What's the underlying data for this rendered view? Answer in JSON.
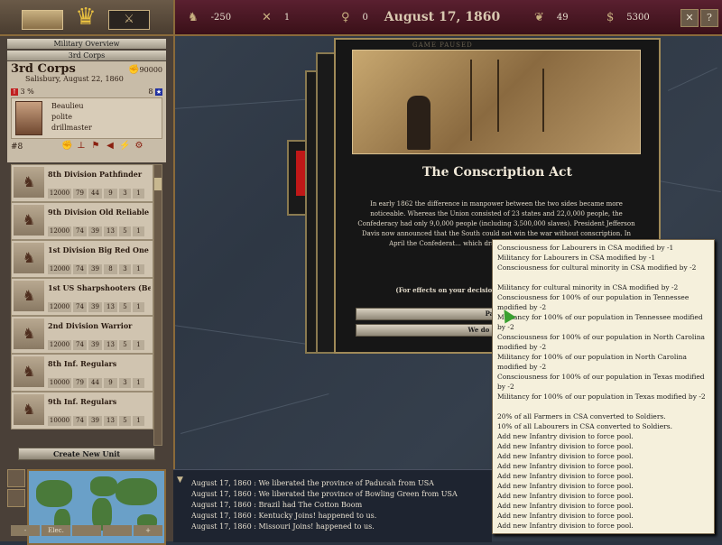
{
  "topbar": {
    "stat1": "-250",
    "stat2": "1",
    "stat3": "0",
    "date": "August 17, 1860",
    "stat4": "49",
    "money": "5300"
  },
  "left_panel": {
    "header": "Military Overview",
    "corps_label": "3rd Corps",
    "corps_name": "3rd Corps",
    "corps_location": "Salisbury, August 22, 1860",
    "strength": "90000",
    "organization": "3 %",
    "rank": "8",
    "leader": {
      "name": "Beaulieu",
      "trait1": "polite",
      "trait2": "drillmaster"
    },
    "leader_id": "#8",
    "units": [
      {
        "name": "8th Division Pathfinder",
        "stats": [
          "12000",
          "79",
          "44",
          "9",
          "3",
          "1"
        ]
      },
      {
        "name": "9th Division Old Reliable",
        "stats": [
          "12000",
          "74",
          "39",
          "13",
          "5",
          "1"
        ]
      },
      {
        "name": "1st Division Big Red One",
        "stats": [
          "12000",
          "74",
          "39",
          "8",
          "3",
          "1"
        ]
      },
      {
        "name": "1st US Sharpshooters (Be",
        "stats": [
          "12000",
          "74",
          "39",
          "13",
          "5",
          "1"
        ]
      },
      {
        "name": "2nd Division Warrior",
        "stats": [
          "12000",
          "74",
          "39",
          "13",
          "5",
          "1"
        ]
      },
      {
        "name": "8th Inf. Regulars",
        "stats": [
          "10000",
          "79",
          "44",
          "9",
          "3",
          "1"
        ]
      },
      {
        "name": "9th Inf. Regulars",
        "stats": [
          "10000",
          "74",
          "39",
          "13",
          "5",
          "1"
        ]
      }
    ],
    "create_button": "Create New Unit"
  },
  "event": {
    "paused": "GAME PAUSED",
    "title": "The Conscription Act",
    "body": "In early 1862 the difference in manpower between the two sides became more noticeable. Whereas the Union consisted of 23 states and 22,0,000 people, the Confederacy had only 9,0,000 people (including 3,500,000 slaves). President Jefferson Davis now announced that the South could not win the war without conscription. In April the Confederat... which drafted white men between ei... ser...",
    "hint": "(For effects on your decision, c... when you move the m...",
    "option1": "Pass...",
    "option2": "We do not nee..."
  },
  "tooltip": {
    "lines": [
      "Consciousness for Labourers in CSA modified by -1",
      "Militancy for Labourers in CSA modified by -1",
      "Consciousness for cultural minority in CSA modified by -2",
      "Militancy for cultural minority in CSA modified by -2",
      "Consciousness for 100% of our population in Tennessee modified by -2",
      "Militancy for 100% of our population in Tennessee modified by -2",
      "Consciousness for 100% of our population in North Carolina modified by -2",
      "Militancy for 100% of our population in North Carolina modified by -2",
      "Consciousness for 100% of our population in Texas modified by -2",
      "Militancy for 100% of our population in Texas modified by -2",
      "20% of all Farmers in CSA converted to Soldiers.",
      "10% of all Labourers in CSA converted to Soldiers.",
      "Add new Infantry division to force pool.",
      "Add new Infantry division to force pool.",
      "Add new Infantry division to force pool.",
      "Add new Infantry division to force pool.",
      "Add new Infantry division to force pool.",
      "Add new Infantry division to force pool.",
      "Add new Infantry division to force pool.",
      "Add new Infantry division to force pool.",
      "Add new Infantry division to force pool.",
      "Add new Infantry division to force pool.",
      "Add new Infantry division to force pool.",
      "Add new Infantry division to force pool."
    ]
  },
  "messages": [
    "August 17, 1860 : We liberated the province of Paducah from USA",
    "August 17, 1860 : We liberated the province of Bowling Green from USA",
    "August 17, 1860 : Brazil had The Cotton Boom",
    "August 17, 1860 : Kentucky Joins! happened to us.",
    "August 17, 1860 : Missouri Joins! happened to us."
  ],
  "minimap_buttons": [
    "-",
    "Elec.",
    "",
    "",
    "+"
  ]
}
